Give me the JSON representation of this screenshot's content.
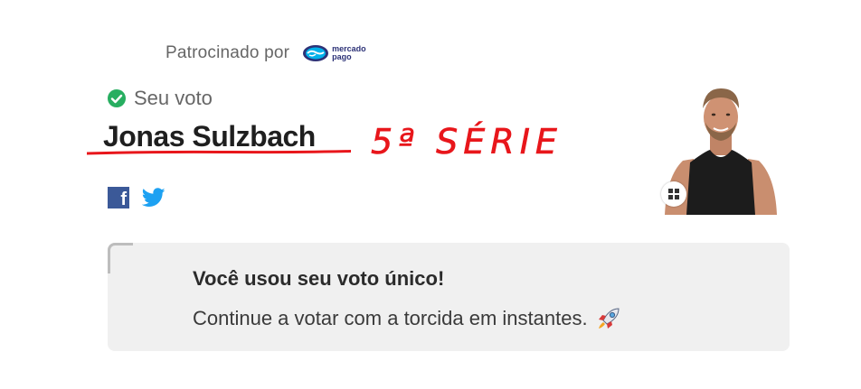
{
  "sponsor": {
    "label": "Patrocinado por",
    "logo_line1": "mercado",
    "logo_line2": "pago",
    "logo_icon": "handshake-icon"
  },
  "vote": {
    "label": "Seu voto",
    "check_icon": "check-circle-icon",
    "candidate": "Jonas Sulzbach",
    "scribble": "5ª SÉRIE"
  },
  "social": {
    "facebook_icon": "facebook-icon",
    "facebook_glyph": "f",
    "twitter_icon": "twitter-icon"
  },
  "notice": {
    "title": "Você usou seu voto único!",
    "body": "Continue a votar com a torcida em instantes.",
    "icon": "rocket-icon"
  },
  "colors": {
    "check_green": "#27ae60",
    "scribble_red": "#e8161b",
    "facebook": "#3b5998",
    "twitter": "#1da1f2",
    "notice_bg": "#f0f0f0",
    "mercadopago_blue": "#2d3277"
  }
}
